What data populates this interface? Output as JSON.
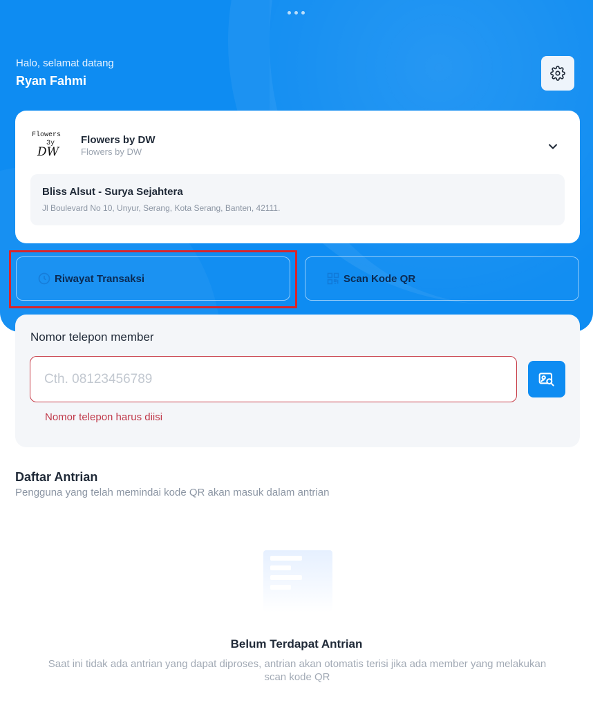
{
  "header": {
    "greeting": "Halo, selamat datang",
    "user_name": "Ryan Fahmi",
    "settings_icon": "gear-icon"
  },
  "store": {
    "logo_text_line1": "Flowers",
    "logo_text_line2": "3y",
    "logo_text_line3": "DW",
    "name": "Flowers by DW",
    "subtitle": "Flowers by DW",
    "branch_name": "Bliss Alsut - Surya Sejahtera",
    "branch_address": "Jl Boulevard No 10, Unyur, Serang, Kota Serang, Banten, 42111."
  },
  "actions": {
    "history_label": "Riwayat Transaksi",
    "scan_label": "Scan Kode QR"
  },
  "member": {
    "label": "Nomor telepon member",
    "placeholder": "Cth. 08123456789",
    "value": "",
    "error": "Nomor telepon harus diisi"
  },
  "queue": {
    "title": "Daftar Antrian",
    "subtitle": "Pengguna yang telah memindai kode QR akan masuk dalam antrian",
    "empty_title": "Belum Terdapat Antrian",
    "empty_desc": "Saat ini tidak ada antrian yang dapat diproses, antrian akan otomatis terisi jika ada member yang melakukan scan kode QR"
  },
  "colors": {
    "primary": "#0e8cf2",
    "error": "#c0394a",
    "highlight": "#d9252a"
  }
}
